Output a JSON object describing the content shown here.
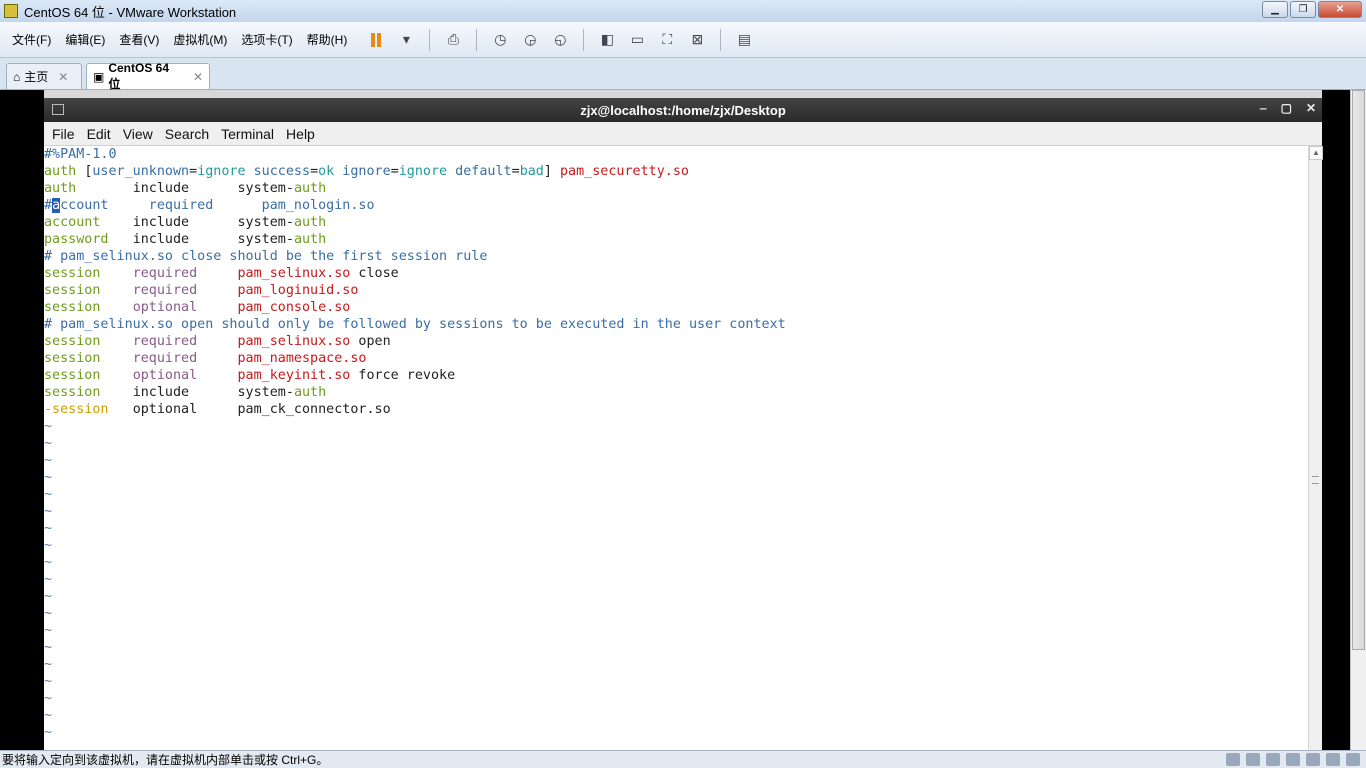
{
  "window": {
    "title": "CentOS 64 位 - VMware Workstation",
    "min": "▁",
    "max": "❐",
    "close": "✕"
  },
  "menubar": {
    "items": [
      "文件(F)",
      "编辑(E)",
      "查看(V)",
      "虚拟机(M)",
      "选项卡(T)",
      "帮助(H)"
    ]
  },
  "tabs": [
    {
      "label": "主页",
      "close": "✕"
    },
    {
      "label": "CentOS 64 位",
      "close": "✕"
    }
  ],
  "guest": {
    "title": "zjx@localhost:/home/zjx/Desktop",
    "controls": [
      "‒",
      "▢",
      "✕"
    ],
    "menu": [
      "File",
      "Edit",
      "View",
      "Search",
      "Terminal",
      "Help"
    ]
  },
  "editor": {
    "lines": [
      [
        {
          "t": "#%PAM-1.0",
          "c": "c-blue"
        }
      ],
      [
        {
          "t": "auth ",
          "c": "c-green"
        },
        {
          "t": "[",
          "c": "c-black"
        },
        {
          "t": "user_unknown",
          "c": "c-blue"
        },
        {
          "t": "=",
          "c": "c-black"
        },
        {
          "t": "ignore",
          "c": "c-teal"
        },
        {
          "t": " success",
          "c": "c-blue"
        },
        {
          "t": "=",
          "c": "c-black"
        },
        {
          "t": "ok",
          "c": "c-teal"
        },
        {
          "t": " ignore",
          "c": "c-blue"
        },
        {
          "t": "=",
          "c": "c-black"
        },
        {
          "t": "ignore",
          "c": "c-teal"
        },
        {
          "t": " default",
          "c": "c-blue"
        },
        {
          "t": "=",
          "c": "c-black"
        },
        {
          "t": "bad",
          "c": "c-teal"
        },
        {
          "t": "] ",
          "c": "c-black"
        },
        {
          "t": "pam_securetty.so",
          "c": "c-red"
        }
      ],
      [
        {
          "t": "auth       ",
          "c": "c-green"
        },
        {
          "t": "include      ",
          "c": "c-black"
        },
        {
          "t": "system-",
          "c": "c-black"
        },
        {
          "t": "auth",
          "c": "c-green"
        }
      ],
      [
        {
          "t": "#",
          "c": "c-blue"
        },
        {
          "t": "a",
          "c": "cursor"
        },
        {
          "t": "ccount     required      pam_nologin.so",
          "c": "c-blue"
        }
      ],
      [
        {
          "t": "account    ",
          "c": "c-green"
        },
        {
          "t": "include      ",
          "c": "c-black"
        },
        {
          "t": "system-",
          "c": "c-black"
        },
        {
          "t": "auth",
          "c": "c-green"
        }
      ],
      [
        {
          "t": "password   ",
          "c": "c-green"
        },
        {
          "t": "include      ",
          "c": "c-black"
        },
        {
          "t": "system-",
          "c": "c-black"
        },
        {
          "t": "auth",
          "c": "c-green"
        }
      ],
      [
        {
          "t": "# pam_selinux.so close should be the first session rule",
          "c": "c-blue"
        }
      ],
      [
        {
          "t": "session    ",
          "c": "c-green"
        },
        {
          "t": "required     ",
          "c": "c-mag"
        },
        {
          "t": "pam_selinux.so",
          "c": "c-red"
        },
        {
          "t": " close",
          "c": "c-black"
        }
      ],
      [
        {
          "t": "session    ",
          "c": "c-green"
        },
        {
          "t": "required     ",
          "c": "c-mag"
        },
        {
          "t": "pam_loginuid.so",
          "c": "c-red"
        }
      ],
      [
        {
          "t": "session    ",
          "c": "c-green"
        },
        {
          "t": "optional     ",
          "c": "c-mag"
        },
        {
          "t": "pam_console.so",
          "c": "c-red"
        }
      ],
      [
        {
          "t": "# pam_selinux.so open should only be followed by sessions to be executed in the user context",
          "c": "c-blue"
        }
      ],
      [
        {
          "t": "session    ",
          "c": "c-green"
        },
        {
          "t": "required     ",
          "c": "c-mag"
        },
        {
          "t": "pam_selinux.so",
          "c": "c-red"
        },
        {
          "t": " open",
          "c": "c-black"
        }
      ],
      [
        {
          "t": "session    ",
          "c": "c-green"
        },
        {
          "t": "required     ",
          "c": "c-mag"
        },
        {
          "t": "pam_namespace.so",
          "c": "c-red"
        }
      ],
      [
        {
          "t": "session    ",
          "c": "c-green"
        },
        {
          "t": "optional     ",
          "c": "c-mag"
        },
        {
          "t": "pam_keyinit.so",
          "c": "c-red"
        },
        {
          "t": " force revoke",
          "c": "c-black"
        }
      ],
      [
        {
          "t": "session    ",
          "c": "c-green"
        },
        {
          "t": "include      ",
          "c": "c-black"
        },
        {
          "t": "system-",
          "c": "c-black"
        },
        {
          "t": "auth",
          "c": "c-green"
        }
      ],
      [
        {
          "t": "-session   ",
          "c": "c-yellow"
        },
        {
          "t": "optional     ",
          "c": "c-black"
        },
        {
          "t": "pam_ck_connector.so",
          "c": "c-black"
        }
      ]
    ],
    "tilde": "~",
    "tilde_count": 19
  },
  "status": {
    "message": "要将输入定向到该虚拟机，请在虚拟机内部单击或按 Ctrl+G。"
  },
  "colors": {
    "accent": "#2a5ab8",
    "titlebar": "#c2d6ee",
    "terminal_title": "#2a2a2a"
  }
}
